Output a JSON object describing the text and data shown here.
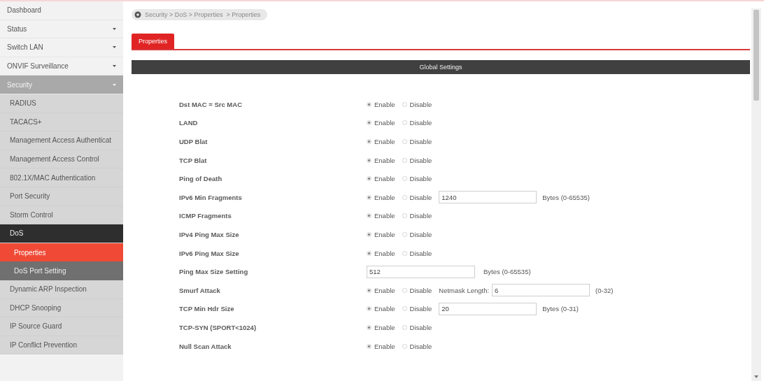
{
  "sidebar": {
    "items": [
      {
        "label": "Dashboard",
        "expandable": false,
        "expanded": false,
        "selected": false
      },
      {
        "label": "Status",
        "expandable": true,
        "expanded": false,
        "selected": false
      },
      {
        "label": "Switch LAN",
        "expandable": true,
        "expanded": false,
        "selected": false
      },
      {
        "label": "ONVIF Surveillance",
        "expandable": true,
        "expanded": false,
        "selected": false
      },
      {
        "label": "Security",
        "expandable": true,
        "expanded": true,
        "selected": false,
        "children": [
          {
            "label": "RADIUS",
            "expandable": false,
            "expanded": false,
            "selected": false
          },
          {
            "label": "TACACS+",
            "expandable": false,
            "expanded": false,
            "selected": false
          },
          {
            "label": "Management Access Authenticat",
            "expandable": false,
            "expanded": false,
            "selected": false
          },
          {
            "label": "Management Access Control",
            "expandable": false,
            "expanded": false,
            "selected": false
          },
          {
            "label": "802.1X/MAC Authentication",
            "expandable": false,
            "expanded": false,
            "selected": false
          },
          {
            "label": "Port Security",
            "expandable": false,
            "expanded": false,
            "selected": false
          },
          {
            "label": "Storm Control",
            "expandable": false,
            "expanded": false,
            "selected": false
          },
          {
            "label": "DoS",
            "expandable": false,
            "expanded": true,
            "selected": false,
            "children": [
              {
                "label": "Properties",
                "expandable": false,
                "expanded": false,
                "selected": true
              },
              {
                "label": "DoS Port Setting",
                "expandable": false,
                "expanded": false,
                "selected": false
              }
            ]
          },
          {
            "label": "Dynamic ARP Inspection",
            "expandable": false,
            "expanded": false,
            "selected": false
          },
          {
            "label": "DHCP Snooping",
            "expandable": false,
            "expanded": false,
            "selected": false
          },
          {
            "label": "IP Source Guard",
            "expandable": false,
            "expanded": false,
            "selected": false
          },
          {
            "label": "IP Conflict Prevention",
            "expandable": false,
            "expanded": false,
            "selected": false
          }
        ]
      }
    ]
  },
  "breadcrumb": "Security > DoS > Properties  > Properties",
  "tabs": [
    {
      "label": "Properties",
      "selected": true
    }
  ],
  "section": {
    "title": "Global Settings"
  },
  "rows": [
    {
      "label": "Dst MAC = Src MAC",
      "options": [
        {
          "label": "Enable",
          "selected": true
        },
        {
          "label": "Disable",
          "selected": false
        }
      ]
    },
    {
      "label": "LAND",
      "options": [
        {
          "label": "Enable",
          "selected": true
        },
        {
          "label": "Disable",
          "selected": false
        }
      ]
    },
    {
      "label": "UDP Blat",
      "options": [
        {
          "label": "Enable",
          "selected": true
        },
        {
          "label": "Disable",
          "selected": false
        }
      ]
    },
    {
      "label": "TCP Blat",
      "options": [
        {
          "label": "Enable",
          "selected": true
        },
        {
          "label": "Disable",
          "selected": false
        }
      ]
    },
    {
      "label": "Ping of Death",
      "options": [
        {
          "label": "Enable",
          "selected": true
        },
        {
          "label": "Disable",
          "selected": false
        }
      ]
    },
    {
      "label": "IPv6 Min Fragments",
      "options": [
        {
          "label": "Enable",
          "selected": true
        },
        {
          "label": "Disable",
          "selected": false
        }
      ],
      "value": "1240",
      "unit": "Bytes (0-65535)"
    },
    {
      "label": "ICMP Fragments",
      "options": [
        {
          "label": "Enable",
          "selected": true
        },
        {
          "label": "Disable",
          "selected": false
        }
      ]
    },
    {
      "label": "IPv4 Ping Max Size",
      "options": [
        {
          "label": "Enable",
          "selected": true
        },
        {
          "label": "Disable",
          "selected": false
        }
      ]
    },
    {
      "label": "IPv6 Ping Max Size",
      "options": [
        {
          "label": "Enable",
          "selected": true
        },
        {
          "label": "Disable",
          "selected": false
        }
      ]
    },
    {
      "label": "Ping Max Size Setting",
      "value": "512",
      "unit": "Bytes (0-65535)"
    },
    {
      "label": "Smurf Attack",
      "options": [
        {
          "label": "Enable",
          "selected": true
        },
        {
          "label": "Disable",
          "selected": false
        }
      ],
      "field_label": "Netmask Length:",
      "value": "6",
      "unit": "(0-32)"
    },
    {
      "label": "TCP Min Hdr Size",
      "options": [
        {
          "label": "Enable",
          "selected": true
        },
        {
          "label": "Disable",
          "selected": false
        }
      ],
      "value": "20",
      "unit": "Bytes (0-31)"
    },
    {
      "label": "TCP-SYN (SPORT<1024)",
      "options": [
        {
          "label": "Enable",
          "selected": true
        },
        {
          "label": "Disable",
          "selected": false
        }
      ]
    },
    {
      "label": "Null Scan Attack",
      "options": [
        {
          "label": "Enable",
          "selected": true
        },
        {
          "label": "Disable",
          "selected": false
        }
      ]
    }
  ]
}
